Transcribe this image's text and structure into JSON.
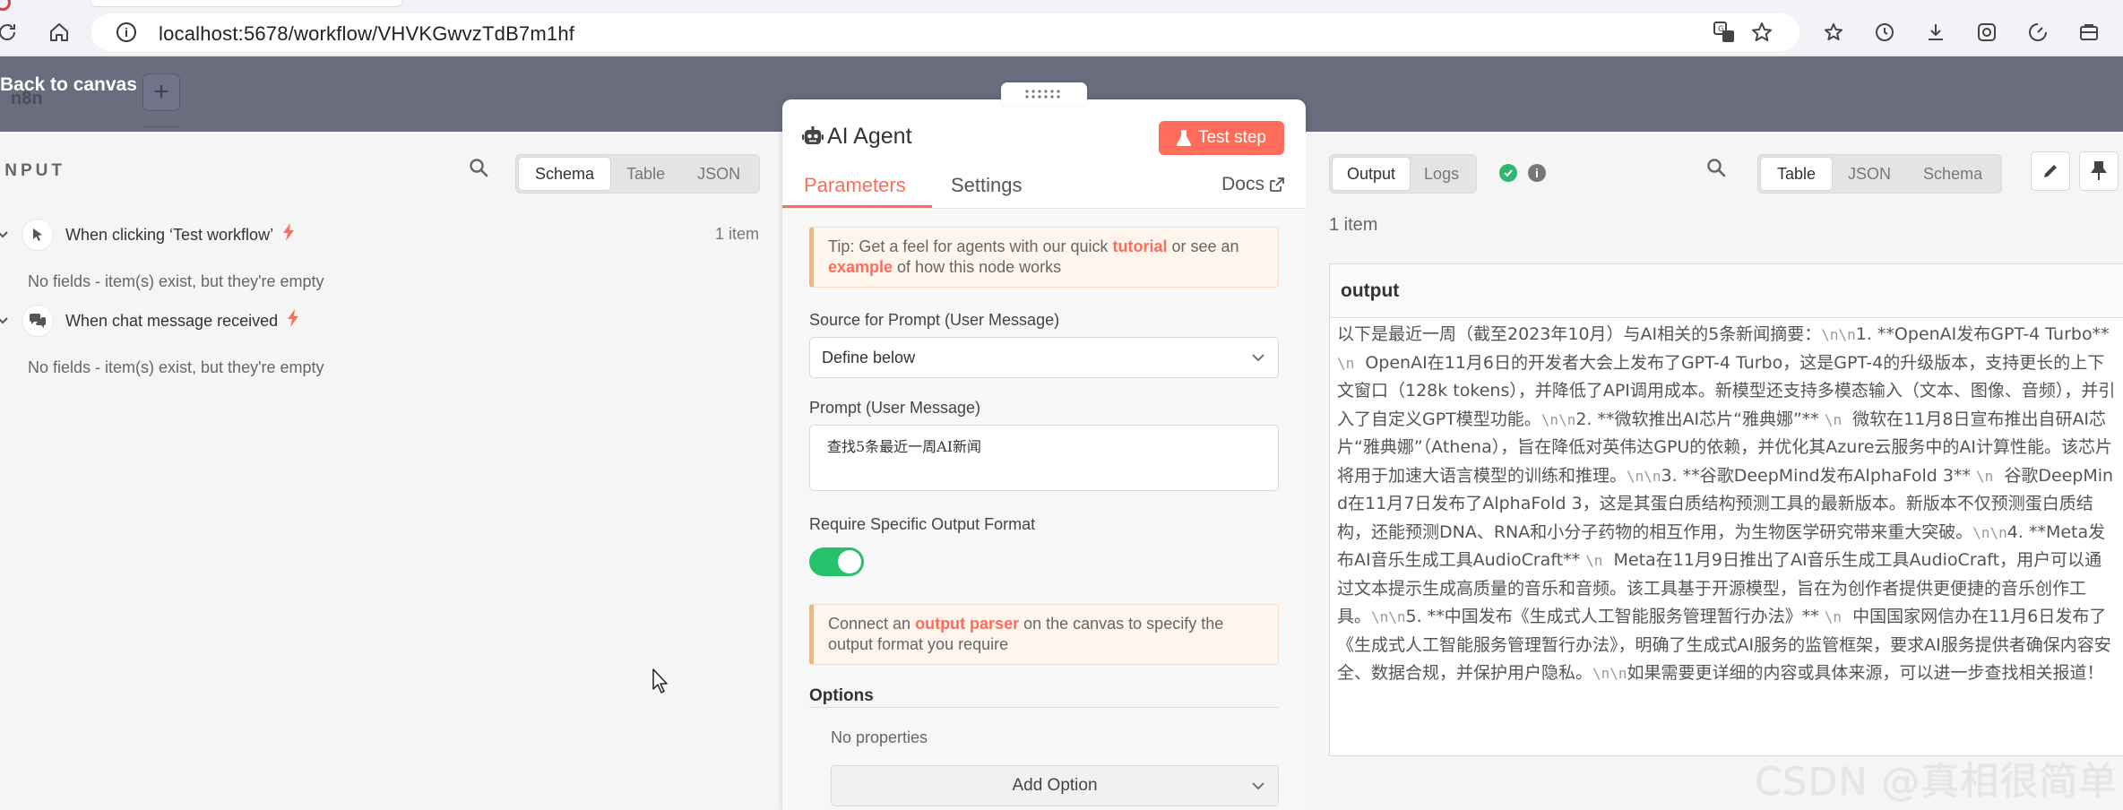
{
  "browser": {
    "url": "localhost:5678/workflow/VHVKGwvzTdB7m1hf"
  },
  "canvas": {
    "back_label": "Back to canvas"
  },
  "input": {
    "title": "INPUT",
    "views": [
      "Schema",
      "Table",
      "JSON"
    ],
    "active_view": "Schema",
    "triggers": [
      {
        "name": "When clicking ‘Test workflow’",
        "count": "1 item",
        "empty_message": "No fields - item(s) exist, but they're empty"
      },
      {
        "name": "When chat message received",
        "empty_message": "No fields - item(s) exist, but they're empty"
      }
    ]
  },
  "node": {
    "title": "AI Agent",
    "test_step_label": "Test step",
    "tabs": [
      "Parameters",
      "Settings"
    ],
    "active_tab": "Parameters",
    "docs_label": "Docs",
    "tip": {
      "prefix": "Tip: Get a feel for agents with our quick ",
      "link1": "tutorial",
      "middle": " or see an ",
      "link2": "example",
      "suffix": " of how this node works"
    },
    "source_label": "Source for Prompt (User Message)",
    "source_value": "Define below",
    "prompt_label": "Prompt (User Message)",
    "prompt_value": "查找5条最近一周AI新闻",
    "require_format_label": "Require Specific Output Format",
    "require_format_enabled": true,
    "parser_notice": {
      "prefix": "Connect an ",
      "link": "output parser",
      "suffix": " on the canvas to specify the output format you require"
    },
    "options_title": "Options",
    "no_properties": "No properties",
    "add_option_label": "Add Option"
  },
  "output": {
    "tabs": [
      "Output",
      "Logs"
    ],
    "active_tab": "Output",
    "views": [
      "Table",
      "JSON",
      "Schema"
    ],
    "active_view": "Table",
    "count": "1 item",
    "column_header": "output",
    "segments": [
      {
        "t": "以下是最近一周（截至2023年10月）与AI相关的5条新闻摘要："
      },
      {
        "esc": "\\n\\n"
      },
      {
        "t": "1. **OpenAI发布GPT-4 Turbo** "
      },
      {
        "esc": "\\n"
      },
      {
        "t": "  OpenAI在11月6日的开发者大会上发布了GPT-4 Turbo，这是GPT-4的升级版本，支持更长的上下文窗口（128k tokens），并降低了API调用成本。新模型还支持多模态输入（文本、图像、音频），并引入了自定义GPT模型功能。"
      },
      {
        "esc": "\\n\\n"
      },
      {
        "t": "2. **微软推出AI芯片“雅典娜”** "
      },
      {
        "esc": "\\n"
      },
      {
        "t": "  微软在11月8日宣布推出自研AI芯片“雅典娜”（Athena），旨在降低对英伟达GPU的依赖，并优化其Azure云服务中的AI计算性能。该芯片将用于加速大语言模型的训练和推理。"
      },
      {
        "esc": "\\n\\n"
      },
      {
        "t": "3. **谷歌DeepMind发布AlphaFold 3** "
      },
      {
        "esc": "\\n"
      },
      {
        "t": "  谷歌DeepMind在11月7日发布了AlphaFold 3，这是其蛋白质结构预测工具的最新版本。新版本不仅预测蛋白质结构，还能预测DNA、RNA和小分子药物的相互作用，为生物医学研究带来重大突破。"
      },
      {
        "esc": "\\n\\n"
      },
      {
        "t": "4. **Meta发布AI音乐生成工具AudioCraft** "
      },
      {
        "esc": "\\n"
      },
      {
        "t": "  Meta在11月9日推出了AI音乐生成工具AudioCraft，用户可以通过文本提示生成高质量的音乐和音频。该工具基于开源模型，旨在为创作者提供更便捷的音乐创作工具。"
      },
      {
        "esc": "\\n\\n"
      },
      {
        "t": "5. **中国发布《生成式人工智能服务管理暂行办法》** "
      },
      {
        "esc": "\\n"
      },
      {
        "t": "  中国国家网信办在11月6日发布了《生成式人工智能服务管理暂行办法》，明确了生成式AI服务的监管框架，要求AI服务提供者确保内容安全、数据合规，并保护用户隐私。"
      },
      {
        "esc": "\\n\\n"
      },
      {
        "t": "如果需要更详细的内容或具体来源，可以进一步查找相关报道！"
      }
    ]
  },
  "watermark": "CSDN @真相很简单",
  "colors": {
    "accent": "#ff6d5a",
    "toggle_on": "#27c06b",
    "success": "#2fb772",
    "canvas_header": "#6a6d7d"
  }
}
